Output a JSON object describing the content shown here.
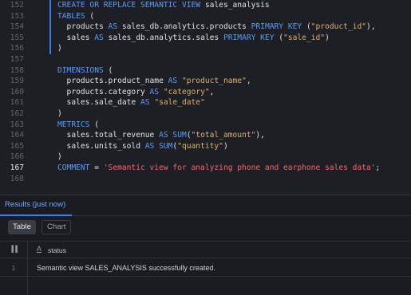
{
  "editor": {
    "active_line": "167",
    "lines": [
      {
        "num": "152",
        "segments": [
          [
            "kw",
            "CREATE OR REPLACE SEMANTIC VIEW"
          ],
          [
            "id",
            " sales_analysis"
          ]
        ]
      },
      {
        "num": "153",
        "segments": [
          [
            "kw",
            "TABLES"
          ],
          [
            "id",
            " ("
          ]
        ]
      },
      {
        "num": "154",
        "segments": [
          [
            "id",
            "  products "
          ],
          [
            "kw",
            "AS"
          ],
          [
            "id",
            " sales_db.analytics.products "
          ],
          [
            "kw",
            "PRIMARY KEY"
          ],
          [
            "id",
            " ("
          ],
          [
            "str",
            "\"product_id\""
          ],
          [
            "id",
            "),"
          ]
        ]
      },
      {
        "num": "155",
        "segments": [
          [
            "id",
            "  sales "
          ],
          [
            "kw",
            "AS"
          ],
          [
            "id",
            " sales_db.analytics.sales "
          ],
          [
            "kw",
            "PRIMARY KEY"
          ],
          [
            "id",
            " ("
          ],
          [
            "str",
            "\"sale_id\""
          ],
          [
            "id",
            ")"
          ]
        ]
      },
      {
        "num": "156",
        "segments": [
          [
            "id",
            ")"
          ]
        ]
      },
      {
        "num": "157",
        "segments": []
      },
      {
        "num": "158",
        "segments": [
          [
            "kw",
            "DIMENSIONS"
          ],
          [
            "id",
            " ("
          ]
        ]
      },
      {
        "num": "159",
        "segments": [
          [
            "id",
            "  products.product_name "
          ],
          [
            "kw",
            "AS"
          ],
          [
            "id",
            " "
          ],
          [
            "str",
            "\"product_name\""
          ],
          [
            "id",
            ","
          ]
        ]
      },
      {
        "num": "160",
        "segments": [
          [
            "id",
            "  products.category "
          ],
          [
            "kw",
            "AS"
          ],
          [
            "id",
            " "
          ],
          [
            "str",
            "\"category\""
          ],
          [
            "id",
            ","
          ]
        ]
      },
      {
        "num": "161",
        "segments": [
          [
            "id",
            "  sales.sale_date "
          ],
          [
            "kw",
            "AS"
          ],
          [
            "id",
            " "
          ],
          [
            "str",
            "\"sale_date\""
          ]
        ]
      },
      {
        "num": "162",
        "segments": [
          [
            "id",
            ")"
          ]
        ]
      },
      {
        "num": "163",
        "segments": [
          [
            "kw",
            "METRICS"
          ],
          [
            "id",
            " ("
          ]
        ]
      },
      {
        "num": "164",
        "segments": [
          [
            "id",
            "  sales.total_revenue "
          ],
          [
            "kw",
            "AS"
          ],
          [
            "id",
            " "
          ],
          [
            "kw",
            "SUM"
          ],
          [
            "id",
            "("
          ],
          [
            "str",
            "\"total_amount\""
          ],
          [
            "id",
            "),"
          ]
        ]
      },
      {
        "num": "165",
        "segments": [
          [
            "id",
            "  sales.units_sold "
          ],
          [
            "kw",
            "AS"
          ],
          [
            "id",
            " "
          ],
          [
            "kw",
            "SUM"
          ],
          [
            "id",
            "("
          ],
          [
            "str",
            "\"quantity\""
          ],
          [
            "id",
            ")"
          ]
        ]
      },
      {
        "num": "166",
        "segments": [
          [
            "id",
            ")"
          ]
        ]
      },
      {
        "num": "167",
        "segments": [
          [
            "kw",
            "COMMENT"
          ],
          [
            "id",
            " = "
          ],
          [
            "str2",
            "'Semantic view for analyzing phone and earphone sales data'"
          ],
          [
            "id",
            ";"
          ]
        ]
      },
      {
        "num": "168",
        "segments": []
      }
    ]
  },
  "results": {
    "title": "Results  (just now)",
    "view_toggle": {
      "table_label": "Table",
      "chart_label": "Chart",
      "selected": "Table"
    },
    "columns": [
      {
        "icon": "A",
        "label": "status"
      }
    ],
    "row_icon": "▐▐",
    "rows": [
      {
        "num": "1",
        "status": "Semantic view SALES_ANALYSIS successfully created."
      }
    ]
  },
  "colors": {
    "keyword": "#5c9cf5",
    "string": "#d7b36b",
    "comment_string": "#ef6a6a",
    "accent": "#3f7be0",
    "background": "#1e1f25"
  }
}
